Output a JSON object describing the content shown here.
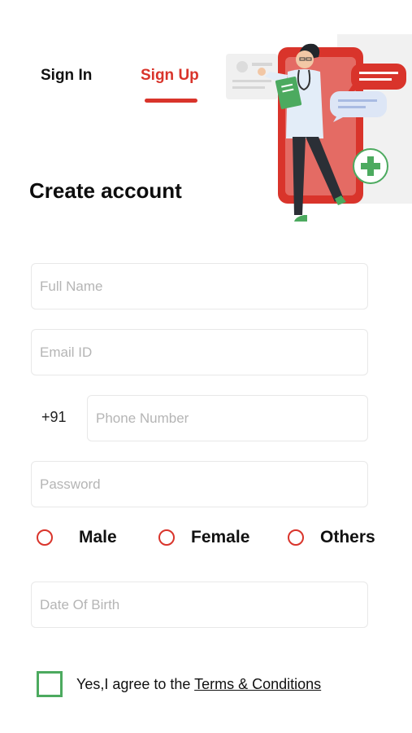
{
  "tabs": {
    "sign_in": "Sign In",
    "sign_up": "Sign Up",
    "active": "sign_up"
  },
  "title": "Create account",
  "fields": {
    "full_name": {
      "placeholder": "Full Name",
      "value": ""
    },
    "email": {
      "placeholder": "Email ID",
      "value": ""
    },
    "country_code": "+91",
    "phone": {
      "placeholder": "Phone Number",
      "value": ""
    },
    "password": {
      "placeholder": "Password",
      "value": ""
    },
    "dob": {
      "placeholder": "Date Of Birth",
      "value": ""
    }
  },
  "gender": {
    "options": [
      "Male",
      "Female",
      "Others"
    ],
    "selected": null
  },
  "agreement": {
    "prefix": "Yes,I agree to the ",
    "link": "Terms & Conditions",
    "checked": false
  },
  "colors": {
    "accent": "#d9342b",
    "checkbox": "#4caa5f",
    "field_border": "#e8e8e8",
    "placeholder": "#b5b5b5"
  },
  "illustration": "doctor-with-phone-illustration"
}
